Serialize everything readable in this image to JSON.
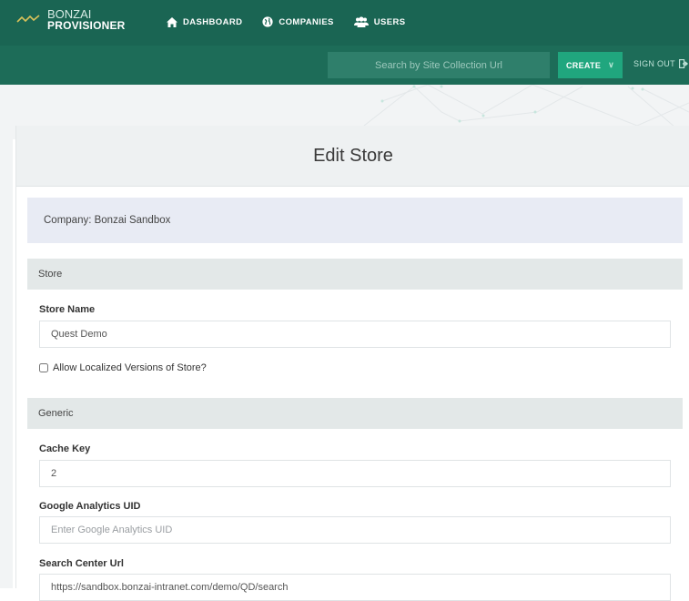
{
  "brand": {
    "line1": "BONZAI",
    "line2": "PROVISIONER"
  },
  "nav": [
    {
      "label": "DASHBOARD",
      "icon": "home-icon"
    },
    {
      "label": "COMPANIES",
      "icon": "globe-icon"
    },
    {
      "label": "USERS",
      "icon": "users-icon"
    }
  ],
  "search": {
    "placeholder": "Search by Site Collection Url"
  },
  "create": {
    "label": "CREATE"
  },
  "signout": {
    "label": "SIGN OUT"
  },
  "page": {
    "title": "Edit Store"
  },
  "company": {
    "text": "Company: Bonzai Sandbox"
  },
  "sections": {
    "store": "Store",
    "generic": "Generic"
  },
  "fields": {
    "store_name": {
      "label": "Store Name",
      "value": "Quest Demo"
    },
    "allow_localized": {
      "label": "Allow Localized Versions of Store?",
      "checked": false
    },
    "cache_key": {
      "label": "Cache Key",
      "value": "2"
    },
    "ga_uid": {
      "label": "Google Analytics UID",
      "value": "",
      "placeholder": "Enter Google Analytics UID"
    },
    "search_center": {
      "label": "Search Center Url",
      "value": "https://sandbox.bonzai-intranet.com/demo/QD/search"
    }
  },
  "colors": {
    "nav_bg": "#1a6553",
    "accent": "#20a67e",
    "panel_head": "#eef1f2",
    "section_bg": "#e3e8e8",
    "company_bg": "#e8ebf4"
  }
}
